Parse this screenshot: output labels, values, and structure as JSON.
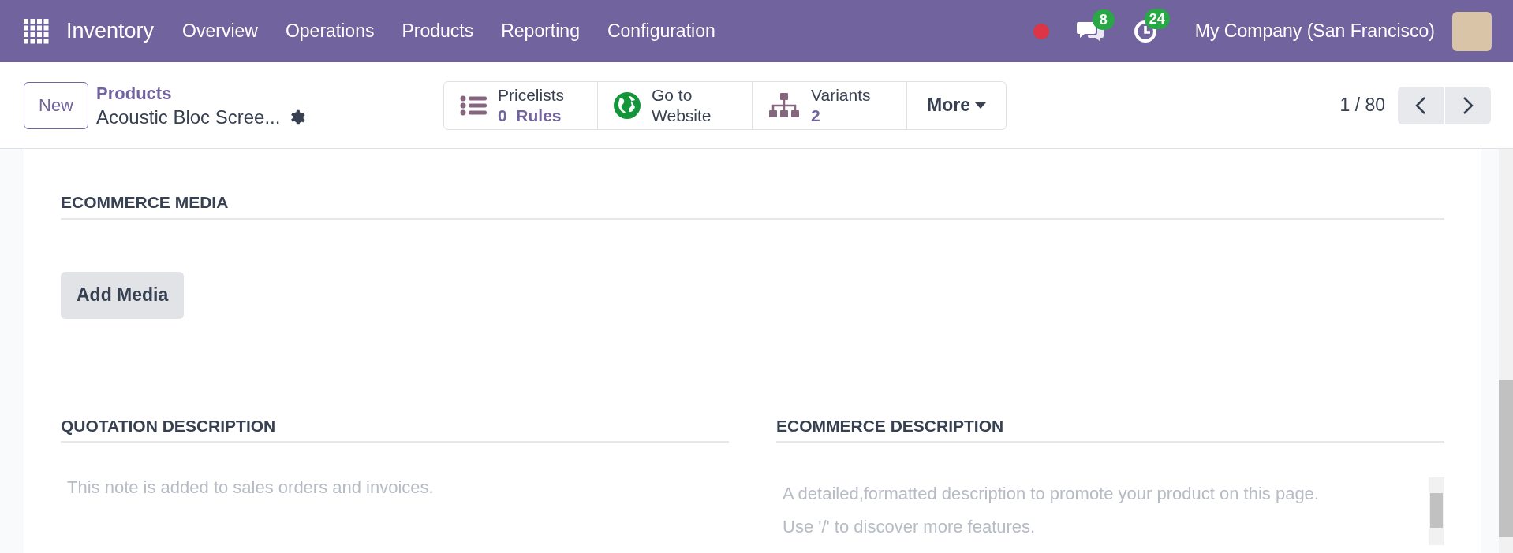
{
  "navbar": {
    "app_name": "Inventory",
    "menu": [
      "Overview",
      "Operations",
      "Products",
      "Reporting",
      "Configuration"
    ],
    "messages_count": "8",
    "activities_count": "24",
    "company": "My Company (San Francisco)"
  },
  "control_panel": {
    "new_button": "New",
    "breadcrumb": "Products",
    "record_name": "Acoustic Bloc Scree...",
    "stat_buttons": [
      {
        "kind": "list",
        "label": "Pricelists",
        "value": "0  Rules"
      },
      {
        "kind": "globe",
        "label": "Go to",
        "value": "Website"
      },
      {
        "kind": "tree",
        "label": "Variants",
        "value": "2"
      }
    ],
    "more_button": "More",
    "pager": "1 / 80"
  },
  "ecommerce_media": {
    "heading": "ECOMMERCE MEDIA",
    "add_button": "Add Media"
  },
  "quotation_description": {
    "heading": "QUOTATION DESCRIPTION",
    "placeholder": "This note is added to sales orders and invoices."
  },
  "ecommerce_description": {
    "heading": "ECOMMERCE DESCRIPTION",
    "placeholder": "A detailed,formatted description to promote your product on this page. Use '/' to discover more features."
  }
}
